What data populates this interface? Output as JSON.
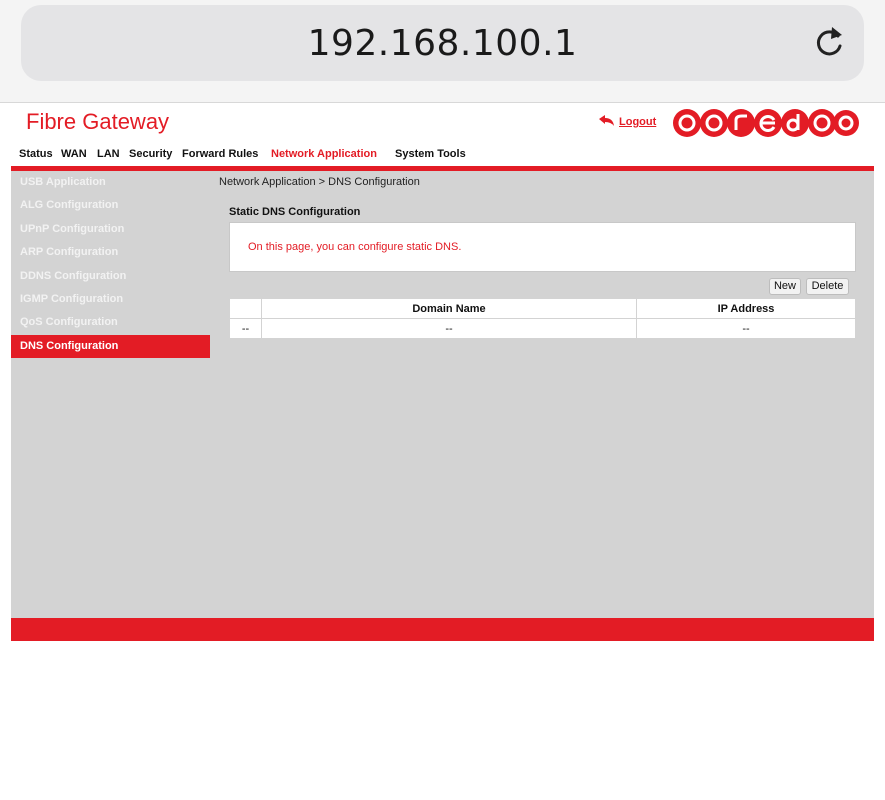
{
  "browser": {
    "url": "192.168.100.1",
    "reload_icon": "reload-icon"
  },
  "header": {
    "brand": "Fibre Gateway",
    "logout_label": "Logout",
    "logo_text": "ooredoo"
  },
  "menu": [
    {
      "label": "Status",
      "active": false
    },
    {
      "label": "WAN",
      "active": false
    },
    {
      "label": "LAN",
      "active": false
    },
    {
      "label": "Security",
      "active": false
    },
    {
      "label": "Forward Rules",
      "active": false
    },
    {
      "label": "Network Application",
      "active": true
    },
    {
      "label": "System Tools",
      "active": false
    }
  ],
  "sidebar": [
    {
      "label": "USB Application",
      "active": false
    },
    {
      "label": "ALG Configuration",
      "active": false
    },
    {
      "label": "UPnP Configuration",
      "active": false
    },
    {
      "label": "ARP Configuration",
      "active": false
    },
    {
      "label": "DDNS Configuration",
      "active": false
    },
    {
      "label": "IGMP Configuration",
      "active": false
    },
    {
      "label": "QoS Configuration",
      "active": false
    },
    {
      "label": "DNS Configuration",
      "active": true
    }
  ],
  "main": {
    "breadcrumb": "Network Application > DNS Configuration",
    "section_title": "Static DNS Configuration",
    "info": "On this page, you can configure static DNS.",
    "buttons": {
      "new": "New",
      "delete": "Delete"
    },
    "table": {
      "headers": [
        "",
        "Domain Name",
        "IP Address"
      ],
      "rows": [
        [
          "--",
          "--",
          "--"
        ]
      ]
    }
  },
  "colors": {
    "accent": "#e31c25",
    "panel": "#d3d3d3"
  }
}
